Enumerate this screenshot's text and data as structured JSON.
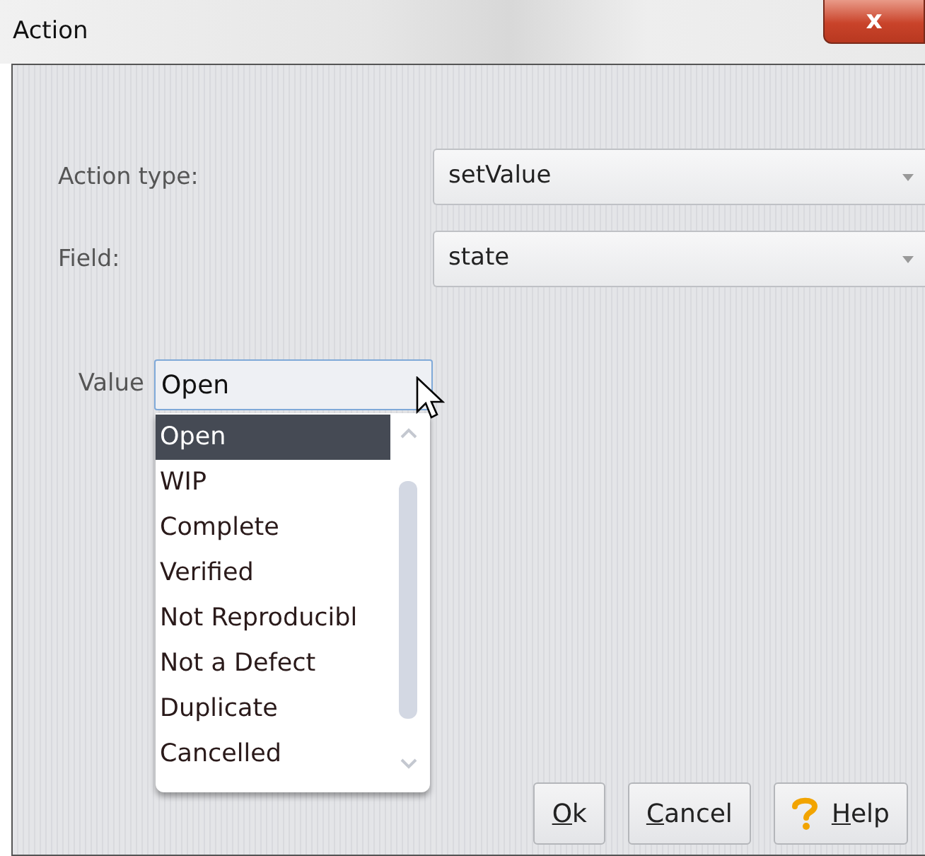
{
  "window": {
    "title": "Action",
    "close_label": "x"
  },
  "fields": [
    {
      "label": "Action type:",
      "value": "setValue"
    },
    {
      "label": "Field:",
      "value": "state"
    }
  ],
  "value_field": {
    "label": "Value",
    "value": "Open",
    "expanded": true,
    "options": [
      {
        "label": "Open",
        "selected": true
      },
      {
        "label": "WIP",
        "selected": false
      },
      {
        "label": "Complete",
        "selected": false
      },
      {
        "label": "Verified",
        "selected": false
      },
      {
        "label": "Not Reproducibl",
        "selected": false
      },
      {
        "label": "Not a Defect",
        "selected": false
      },
      {
        "label": "Duplicate",
        "selected": false
      },
      {
        "label": "Cancelled",
        "selected": false
      }
    ]
  },
  "buttons": [
    {
      "label": "Ok",
      "underline_first": true,
      "kind": "plain"
    },
    {
      "label": "Cancel",
      "underline_first": true,
      "kind": "plain"
    },
    {
      "label": "Help",
      "underline_first": true,
      "kind": "help"
    }
  ]
}
